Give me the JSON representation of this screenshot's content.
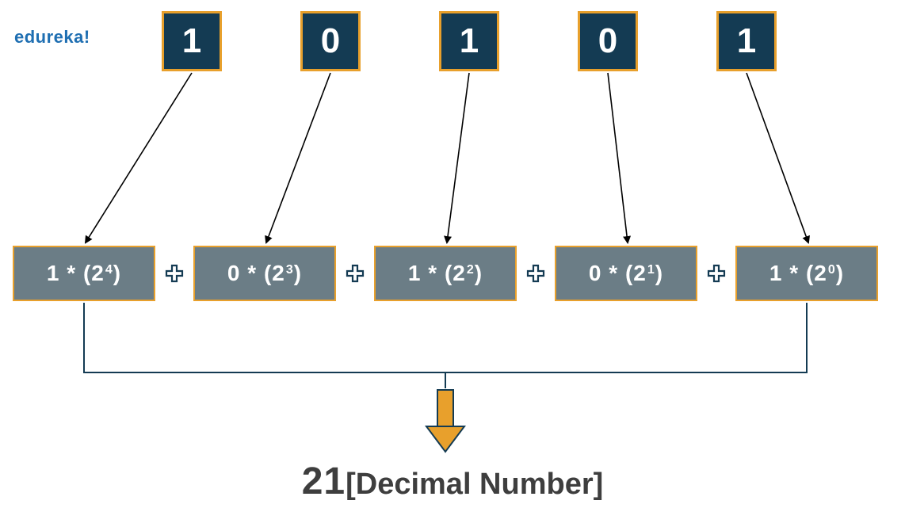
{
  "brand": "edureka!",
  "bits": [
    "1",
    "0",
    "1",
    "0",
    "1"
  ],
  "terms": [
    {
      "coef": "1",
      "exp": "4"
    },
    {
      "coef": "0",
      "exp": "3"
    },
    {
      "coef": "1",
      "exp": "2"
    },
    {
      "coef": "0",
      "exp": "1"
    },
    {
      "coef": "1",
      "exp": "0"
    }
  ],
  "plus": "+",
  "result_value": "21",
  "result_label": "[Decimal Number]"
}
